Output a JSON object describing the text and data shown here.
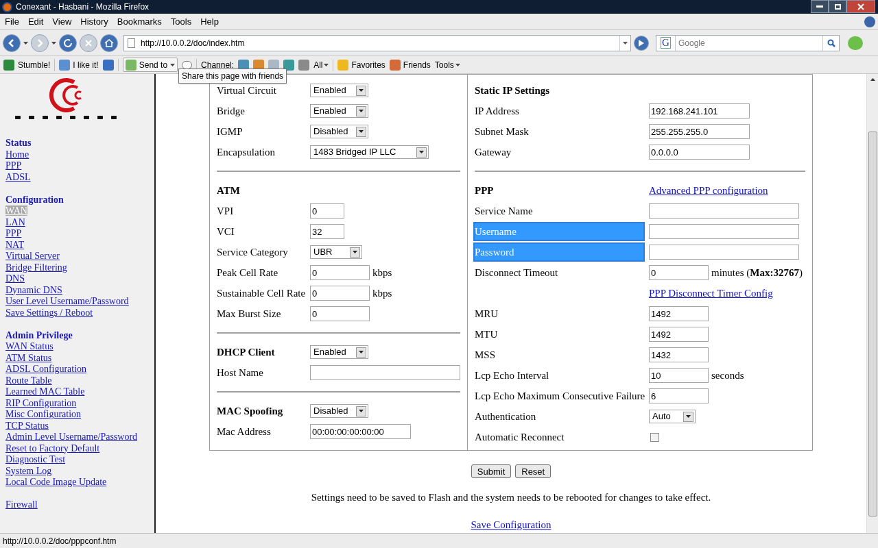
{
  "window": {
    "title": "Conexant - Hasbani - Mozilla Firefox"
  },
  "menu": [
    "File",
    "Edit",
    "View",
    "History",
    "Bookmarks",
    "Tools",
    "Help"
  ],
  "nav": {
    "url": "http://10.0.0.2/doc/index.htm",
    "search_placeholder": "Google",
    "search_engine": "G"
  },
  "toolbar": [
    "Stumble!",
    "I like it!",
    "Send to",
    "Channel:",
    "All",
    "Favorites",
    "Friends",
    "Tools"
  ],
  "tooltip": "Share this page with friends",
  "sidebar": [
    {
      "title": "Status",
      "links": [
        {
          "label": "Home",
          "selected": false
        },
        {
          "label": "PPP",
          "selected": false
        },
        {
          "label": "ADSL",
          "selected": false
        }
      ]
    },
    {
      "title": "Configuration",
      "links": [
        {
          "label": "WAN",
          "selected": true
        },
        {
          "label": "LAN",
          "selected": false
        },
        {
          "label": "PPP",
          "selected": false
        },
        {
          "label": "NAT",
          "selected": false
        },
        {
          "label": "Virtual Server",
          "selected": false
        },
        {
          "label": "Bridge Filtering",
          "selected": false
        },
        {
          "label": "DNS",
          "selected": false
        },
        {
          "label": "Dynamic DNS",
          "selected": false
        },
        {
          "label": "User Level Username/Password",
          "selected": false
        },
        {
          "label": "Save Settings / Reboot",
          "selected": false
        }
      ]
    },
    {
      "title": "Admin Privilege",
      "links": [
        {
          "label": "WAN Status",
          "selected": false
        },
        {
          "label": "ATM Status",
          "selected": false
        },
        {
          "label": "ADSL Configuration",
          "selected": false
        },
        {
          "label": "Route Table",
          "selected": false
        },
        {
          "label": "Learned MAC Table",
          "selected": false
        },
        {
          "label": "RIP Configuration",
          "selected": false
        },
        {
          "label": "Misc Configuration",
          "selected": false
        },
        {
          "label": "TCP Status",
          "selected": false
        },
        {
          "label": "Admin Level Username/Password",
          "selected": false
        },
        {
          "label": "Reset to Factory Default",
          "selected": false
        },
        {
          "label": "Diagnostic Test",
          "selected": false
        },
        {
          "label": "System Log",
          "selected": false
        },
        {
          "label": "Local Code Image Update",
          "selected": false
        }
      ]
    },
    {
      "links": [
        {
          "label": "Firewall",
          "selected": false
        }
      ]
    }
  ],
  "columns": [
    [
      {
        "rows": [
          {
            "label": "Virtual Circuit",
            "heading": false,
            "highlighted": false,
            "kind": "select",
            "value": "Enabled"
          },
          {
            "label": "Bridge",
            "heading": false,
            "highlighted": false,
            "kind": "select",
            "value": "Enabled"
          },
          {
            "label": "IGMP",
            "heading": false,
            "highlighted": false,
            "kind": "select",
            "value": "Disabled"
          },
          {
            "label": "Encapsulation",
            "heading": false,
            "highlighted": false,
            "kind": "select",
            "value": "1483 Bridged IP LLC"
          }
        ]
      },
      {
        "rows": [
          {
            "label": "ATM",
            "heading": true,
            "highlighted": false,
            "kind": "none"
          },
          {
            "label": "VPI",
            "heading": false,
            "highlighted": false,
            "kind": "input",
            "value": "0"
          },
          {
            "label": "VCI",
            "heading": false,
            "highlighted": false,
            "kind": "input",
            "value": "32"
          },
          {
            "label": "Service Category",
            "heading": false,
            "highlighted": false,
            "kind": "select",
            "value": "UBR"
          },
          {
            "label": "Peak Cell Rate",
            "heading": false,
            "highlighted": false,
            "kind": "input",
            "value": "0",
            "unit": "kbps"
          },
          {
            "label": "Sustainable Cell Rate",
            "heading": false,
            "highlighted": false,
            "kind": "input",
            "value": "0",
            "unit": "kbps"
          },
          {
            "label": "Max Burst Size",
            "heading": false,
            "highlighted": false,
            "kind": "input",
            "value": "0"
          }
        ]
      },
      {
        "rows": [
          {
            "label": "DHCP Client",
            "heading": true,
            "highlighted": false,
            "kind": "select",
            "value": "Enabled"
          },
          {
            "label": "Host Name",
            "heading": false,
            "highlighted": false,
            "kind": "input"
          }
        ]
      },
      {
        "rows": [
          {
            "label": "MAC Spoofing",
            "heading": true,
            "highlighted": false,
            "kind": "select",
            "value": "Disabled"
          },
          {
            "label": "Mac Address",
            "heading": false,
            "highlighted": false,
            "kind": "input",
            "value": "00:00:00:00:00:00"
          }
        ]
      }
    ],
    [
      {
        "rows": [
          {
            "label": "Static IP Settings",
            "heading": true,
            "highlighted": false,
            "kind": "none"
          },
          {
            "label": "IP Address",
            "heading": false,
            "highlighted": false,
            "kind": "input",
            "value": "192.168.241.101"
          },
          {
            "label": "Subnet Mask",
            "heading": false,
            "highlighted": false,
            "kind": "input",
            "value": "255.255.255.0"
          },
          {
            "label": "Gateway",
            "heading": false,
            "highlighted": false,
            "kind": "input",
            "value": "0.0.0.0"
          }
        ]
      },
      {
        "rows": [
          {
            "label": "PPP",
            "heading": true,
            "highlighted": false,
            "kind": "link",
            "link": "Advanced PPP configuration"
          },
          {
            "label": "Service Name",
            "heading": false,
            "highlighted": false,
            "kind": "input"
          },
          {
            "label": "Username",
            "heading": false,
            "highlighted": true,
            "kind": "input"
          },
          {
            "label": "Password",
            "heading": false,
            "highlighted": true,
            "kind": "input"
          },
          {
            "label": "Disconnect Timeout",
            "heading": false,
            "highlighted": false,
            "kind": "input",
            "value": "0",
            "unit": "minutes (**Max:32767**)"
          },
          {
            "kind": "link",
            "link": "PPP Disconnect Timer Config"
          },
          {
            "label": "MRU",
            "heading": false,
            "highlighted": false,
            "kind": "input",
            "value": "1492"
          },
          {
            "label": "MTU",
            "heading": false,
            "highlighted": false,
            "kind": "input",
            "value": "1492"
          },
          {
            "label": "MSS",
            "heading": false,
            "highlighted": false,
            "kind": "input",
            "value": "1432"
          },
          {
            "label": "Lcp Echo Interval",
            "heading": false,
            "highlighted": false,
            "kind": "input",
            "value": "10",
            "unit": "seconds"
          },
          {
            "label": "Lcp Echo Maximum Consecutive Failure",
            "heading": false,
            "highlighted": false,
            "kind": "input",
            "value": "6"
          },
          {
            "label": "Authentication",
            "heading": false,
            "highlighted": false,
            "kind": "select",
            "value": "Auto"
          },
          {
            "label": "Automatic Reconnect",
            "heading": false,
            "highlighted": false,
            "kind": "checkbox",
            "checked": false
          }
        ]
      }
    ]
  ],
  "buttons": [
    "Submit",
    "Reset"
  ],
  "note": "Settings need to be saved to Flash and the system needs to be rebooted for changes to take effect.",
  "save_link": "Save Configuration",
  "status_bar": "http://10.0.0.2/doc/pppconf.htm"
}
